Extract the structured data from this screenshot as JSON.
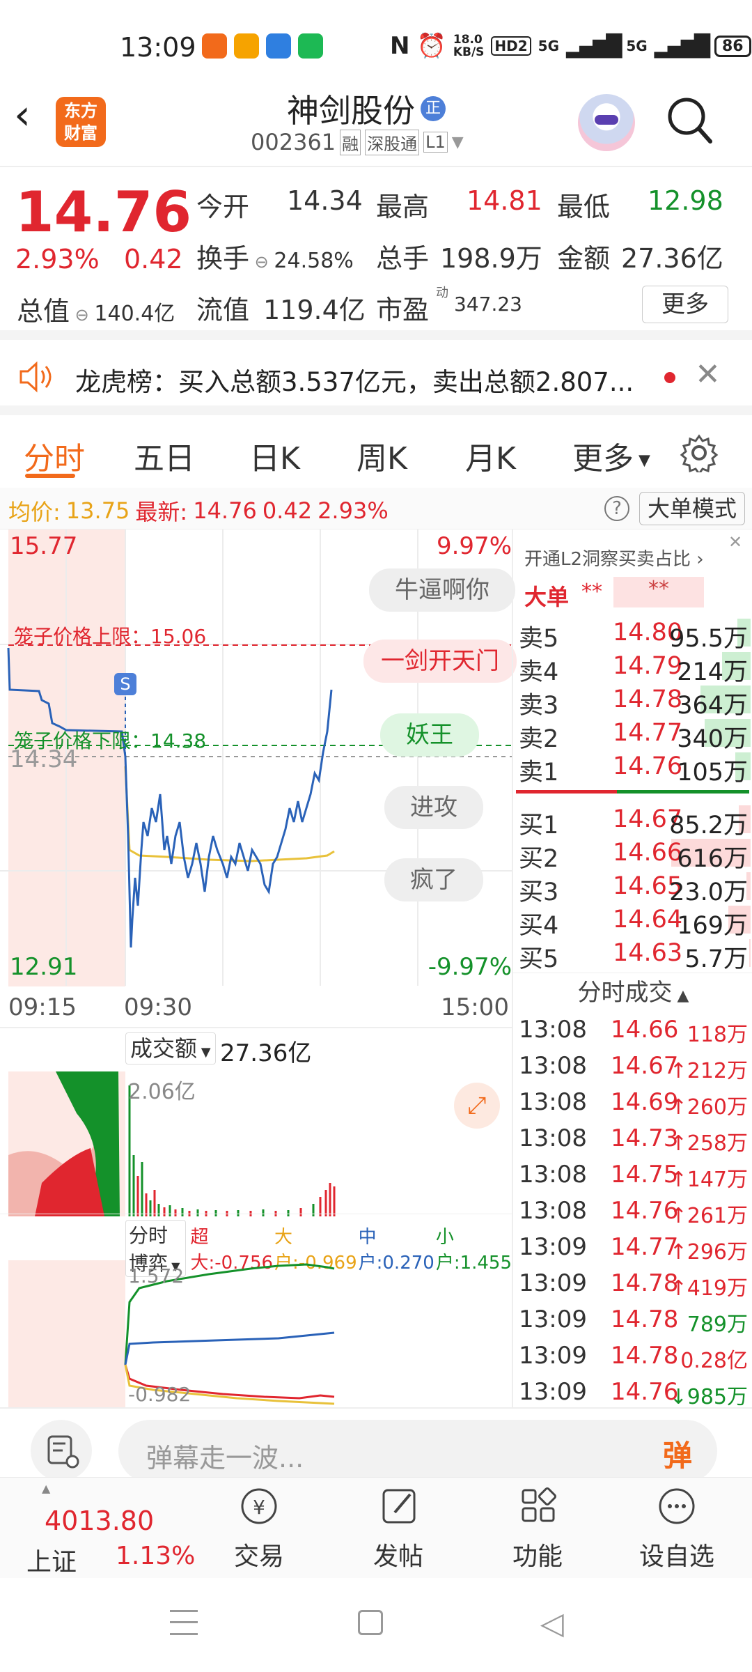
{
  "status": {
    "time": "13:09",
    "net_speed": "18.0",
    "net_unit": "KB/S",
    "hd": "HD2",
    "sig1": "5G",
    "sig2": "5G",
    "battery": "86"
  },
  "header": {
    "logo_text1": "东方",
    "logo_text2": "财富",
    "stock_name": "神剑股份",
    "badge": "正",
    "code": "002361",
    "tag1": "融",
    "tag2": "深股通",
    "tag3": "L1"
  },
  "quote": {
    "price": "14.76",
    "pct": "2.93%",
    "change": "0.42",
    "open_label": "今开",
    "open": "14.34",
    "high_label": "最高",
    "high": "14.81",
    "low_label": "最低",
    "low": "12.98",
    "turnover_label": "换手",
    "turnover": "24.58%",
    "volume_label": "总手",
    "volume": "198.9万",
    "amount_label": "金额",
    "amount": "27.36亿",
    "mktcap_label": "总值",
    "mktcap": "140.4亿",
    "float_label": "流值",
    "float": "119.4亿",
    "pe_label": "市盈",
    "pe_sup": "动",
    "pe": "347.23",
    "more_btn": "更多"
  },
  "banner": {
    "text": "龙虎榜：买入总额3.537亿元，卖出总额2.807..."
  },
  "tabs": [
    "分时",
    "五日",
    "日K",
    "周K",
    "月K",
    "更多"
  ],
  "infobar": {
    "avg_label": "均价:",
    "avg": "13.75",
    "last_label": "最新:",
    "last": "14.76",
    "chg": "0.42",
    "pct": "2.93%",
    "mode_btn": "大单模式"
  },
  "chart": {
    "y_high": "15.77",
    "y_high_pct": "9.97%",
    "y_mid": "14.34",
    "y_low": "12.91",
    "y_low_pct": "-9.97%",
    "cage_upper": "笼子价格上限：15.06",
    "cage_lower": "笼子价格下限：14.38",
    "s_marker": "S",
    "t_start": "09:15",
    "t_open": "09:30",
    "t_end": "15:00",
    "bullets": [
      "牛逼啊你",
      "一剑开天门",
      "妖王",
      "进攻",
      "疯了"
    ],
    "vol_label": "成交额",
    "vol_total": "27.36亿",
    "vol_max": "2.06亿",
    "game_label": "分时博弈",
    "game_items": [
      {
        "label": "超大:",
        "value": "-0.756",
        "color": "#e0262f"
      },
      {
        "label": "大户:",
        "value": "-0.969",
        "color": "#e8a317"
      },
      {
        "label": "中户:",
        "value": "0.270",
        "color": "#2a62b8"
      },
      {
        "label": "小户:",
        "value": "1.455",
        "color": "#14912a"
      }
    ],
    "game_max": "1.572",
    "game_min": "-0.982"
  },
  "orderbook": {
    "l2_text": "开通L2洞察买卖占比",
    "big_label": "大单",
    "big_v1": "**",
    "big_v2": "**",
    "asks": [
      {
        "label": "卖5",
        "price": "14.80",
        "vol": "95.5万",
        "bar": 0.16
      },
      {
        "label": "卖4",
        "price": "14.79",
        "vol": "214万",
        "bar": 0.34
      },
      {
        "label": "卖3",
        "price": "14.78",
        "vol": "364万",
        "bar": 0.6
      },
      {
        "label": "卖2",
        "price": "14.77",
        "vol": "340万",
        "bar": 0.55
      },
      {
        "label": "卖1",
        "price": "14.76",
        "vol": "105万",
        "bar": 0.18
      }
    ],
    "bids": [
      {
        "label": "买1",
        "price": "14.67",
        "vol": "85.2万",
        "bar": 0.14
      },
      {
        "label": "买2",
        "price": "14.66",
        "vol": "616万",
        "bar": 0.95
      },
      {
        "label": "买3",
        "price": "14.65",
        "vol": "23.0万",
        "bar": 0.05
      },
      {
        "label": "买4",
        "price": "14.64",
        "vol": "169万",
        "bar": 0.27
      },
      {
        "label": "买5",
        "price": "14.63",
        "vol": "5.7万",
        "bar": 0.02
      }
    ],
    "trades_label": "分时成交",
    "trades": [
      {
        "t": "13:08",
        "p": "14.66",
        "v": "118万",
        "dir": "",
        "pc": "red",
        "vc": "red"
      },
      {
        "t": "13:08",
        "p": "14.67",
        "v": "212万",
        "dir": "↑",
        "pc": "red",
        "vc": "red"
      },
      {
        "t": "13:08",
        "p": "14.69",
        "v": "260万",
        "dir": "↑",
        "pc": "red",
        "vc": "red"
      },
      {
        "t": "13:08",
        "p": "14.73",
        "v": "258万",
        "dir": "↑",
        "pc": "red",
        "vc": "red"
      },
      {
        "t": "13:08",
        "p": "14.75",
        "v": "147万",
        "dir": "↑",
        "pc": "red",
        "vc": "red"
      },
      {
        "t": "13:08",
        "p": "14.76",
        "v": "261万",
        "dir": "↑",
        "pc": "red",
        "vc": "red"
      },
      {
        "t": "13:09",
        "p": "14.77",
        "v": "296万",
        "dir": "↑",
        "pc": "red",
        "vc": "red"
      },
      {
        "t": "13:09",
        "p": "14.78",
        "v": "419万",
        "dir": "↑",
        "pc": "red",
        "vc": "red"
      },
      {
        "t": "13:09",
        "p": "14.78",
        "v": "789万",
        "dir": "",
        "pc": "red",
        "vc": "green"
      },
      {
        "t": "13:09",
        "p": "14.78",
        "v": "0.28亿",
        "dir": "",
        "pc": "red",
        "vc": "red"
      },
      {
        "t": "13:09",
        "p": "14.76",
        "v": "985万",
        "dir": "↓",
        "pc": "red",
        "vc": "green"
      }
    ]
  },
  "bottombar": {
    "placeholder": "弹幕走一波...",
    "btn": "弹"
  },
  "nav": {
    "index_value": "4013.80",
    "index_name": "上证",
    "index_pct": "1.13%",
    "items": [
      "交易",
      "发帖",
      "功能",
      "设自选"
    ]
  },
  "colors": {
    "up": "#e0262f",
    "down": "#14912a",
    "price_line": "#2a62b8",
    "avg_line": "#e8c13a",
    "accent": "#f26a1b"
  }
}
